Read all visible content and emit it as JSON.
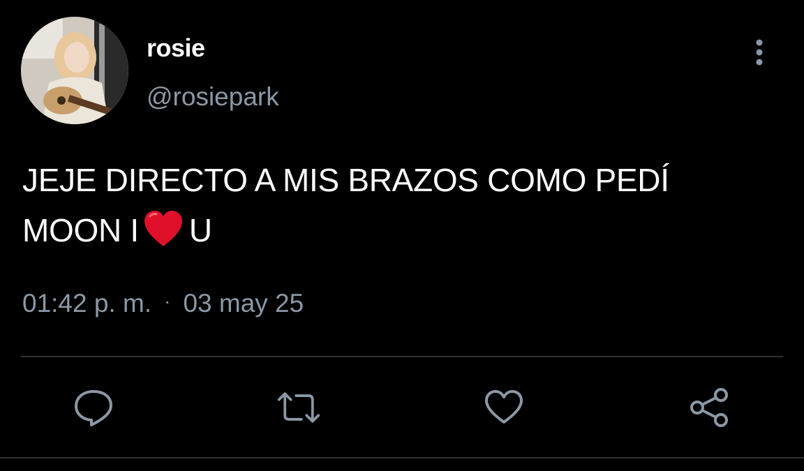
{
  "user": {
    "display_name": "rosie",
    "handle": "@rosiepark",
    "avatar_icon": "profile-photo"
  },
  "tweet": {
    "line1": "JEJE DIRECTO A MIS BRAZOS COMO PEDÍ",
    "line2_before": "MOON I",
    "line2_emoji": "red-heart-emoji",
    "line2_after": "U",
    "time": "01:42 p. m.",
    "separator": "·",
    "date": "03 may 25"
  },
  "actions": {
    "reply_icon": "reply-icon",
    "retweet_icon": "retweet-icon",
    "like_icon": "heart-icon",
    "share_icon": "share-icon",
    "more_icon": "more-vertical-icon"
  },
  "colors": {
    "background": "#000000",
    "text_primary": "#ffffff",
    "text_secondary": "#8b98a5",
    "divider": "#2f3336",
    "heart_emoji": "#e0102a"
  }
}
